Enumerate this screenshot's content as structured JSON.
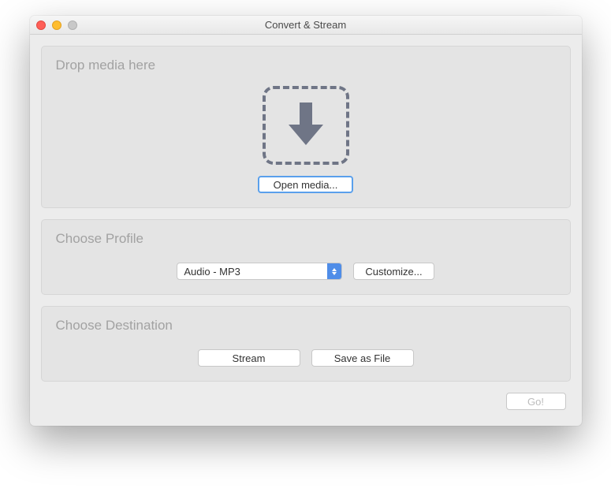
{
  "window": {
    "title": "Convert & Stream"
  },
  "drop": {
    "heading": "Drop media here",
    "open_label": "Open media..."
  },
  "profile": {
    "heading": "Choose Profile",
    "selected": "Audio - MP3",
    "customize_label": "Customize..."
  },
  "destination": {
    "heading": "Choose Destination",
    "stream_label": "Stream",
    "save_label": "Save as File"
  },
  "footer": {
    "go_label": "Go!"
  }
}
